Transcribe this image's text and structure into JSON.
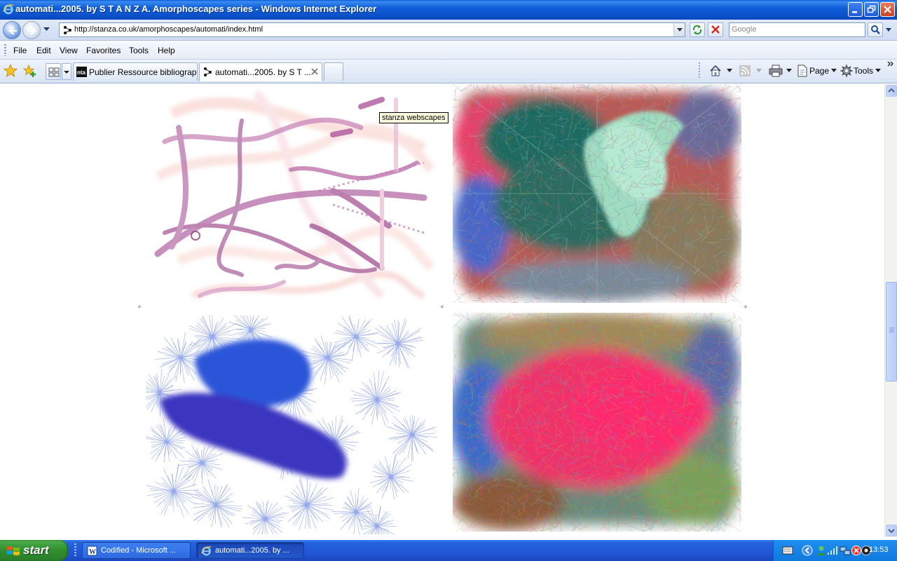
{
  "window": {
    "title": "automati...2005. by S T A N Z A. Amorphoscapes series - Windows Internet Explorer"
  },
  "address_bar": {
    "url": "http://stanza.co.uk/amorphoscapes/automati/index.html",
    "search_placeholder": "Google"
  },
  "menu": {
    "items": [
      "File",
      "Edit",
      "View",
      "Favorites",
      "Tools",
      "Help"
    ]
  },
  "tabs": [
    {
      "label": "Publier Ressource bibliograph...",
      "active": false
    },
    {
      "label": "automati...2005. by S T ...",
      "active": true
    }
  ],
  "command_bar": {
    "page_label": "Page",
    "tools_label": "Tools"
  },
  "content": {
    "tooltip": "stanza webscapes",
    "plus_marker": "+"
  },
  "taskbar": {
    "start_label": "start",
    "items": [
      {
        "label": "Codified - Microsoft ...",
        "icon": "word-icon",
        "active": false
      },
      {
        "label": "automati...2005. by ...",
        "icon": "ie-icon",
        "active": true
      }
    ],
    "clock": "13:53"
  },
  "colors": {
    "title_bar": "#0b4fc8",
    "taskbar": "#2157d6",
    "start_button": "#2f8f2f"
  }
}
